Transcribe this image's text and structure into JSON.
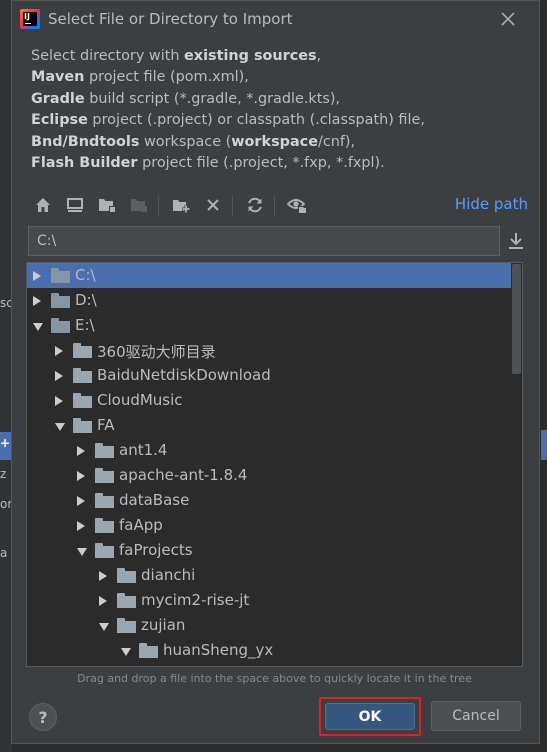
{
  "background_fragments": [
    "sc",
    "+",
    "z",
    "or",
    "a"
  ],
  "dialog": {
    "title": "Select File or Directory to Import",
    "app_icon_text": "IJ"
  },
  "description": {
    "line1_prefix": "Select directory with ",
    "line1_bold": "existing sources",
    "line1_suffix": ",",
    "line2_bold": "Maven",
    "line2_rest": " project file (pom.xml),",
    "line3_bold": "Gradle",
    "line3_rest": " build script (*.gradle, *.gradle.kts),",
    "line4_bold": "Eclipse",
    "line4_rest": " project (.project) or classpath (.classpath) file,",
    "line5_bold": "Bnd/Bndtools",
    "line5_mid": " workspace (",
    "line5_bold2": "workspace",
    "line5_rest": "/cnf),",
    "line6_bold": "Flash Builder",
    "line6_rest": " project file (.project, *.fxp, *.fxpl)."
  },
  "toolbar": {
    "icons": [
      "home-icon",
      "desktop-icon",
      "project-folder-icon",
      "module-folder-icon",
      "new-folder-icon",
      "delete-icon",
      "refresh-icon",
      "show-hidden-icon"
    ],
    "hide_path_label": "Hide path"
  },
  "path": {
    "value": "C:\\"
  },
  "tree": {
    "items": [
      {
        "label": "C:\\",
        "depth": 0,
        "expanded": false,
        "drive": true,
        "selected": true
      },
      {
        "label": "D:\\",
        "depth": 0,
        "expanded": false,
        "drive": true
      },
      {
        "label": "E:\\",
        "depth": 0,
        "expanded": true,
        "drive": true
      },
      {
        "label": "360驱动大师目录",
        "depth": 1,
        "expanded": false
      },
      {
        "label": "BaiduNetdiskDownload",
        "depth": 1,
        "expanded": false
      },
      {
        "label": "CloudMusic",
        "depth": 1,
        "expanded": false
      },
      {
        "label": "FA",
        "depth": 1,
        "expanded": true
      },
      {
        "label": "ant1.4",
        "depth": 2,
        "expanded": false
      },
      {
        "label": "apache-ant-1.8.4",
        "depth": 2,
        "expanded": false
      },
      {
        "label": "dataBase",
        "depth": 2,
        "expanded": false
      },
      {
        "label": "faApp",
        "depth": 2,
        "expanded": false
      },
      {
        "label": "faProjects",
        "depth": 2,
        "expanded": true
      },
      {
        "label": "dianchi",
        "depth": 3,
        "expanded": false
      },
      {
        "label": "mycim2-rise-jt",
        "depth": 3,
        "expanded": false
      },
      {
        "label": "zujian",
        "depth": 3,
        "expanded": true
      },
      {
        "label": "huanSheng_yx",
        "depth": 4,
        "expanded": true
      }
    ]
  },
  "hint": "Drag and drop a file into the space above to quickly locate it in the tree",
  "buttons": {
    "help": "?",
    "ok": "OK",
    "cancel": "Cancel"
  },
  "colors": {
    "accent": "#4b6eaf",
    "ok_button": "#365880",
    "link": "#589df6",
    "highlight_box": "#e01f1f"
  }
}
